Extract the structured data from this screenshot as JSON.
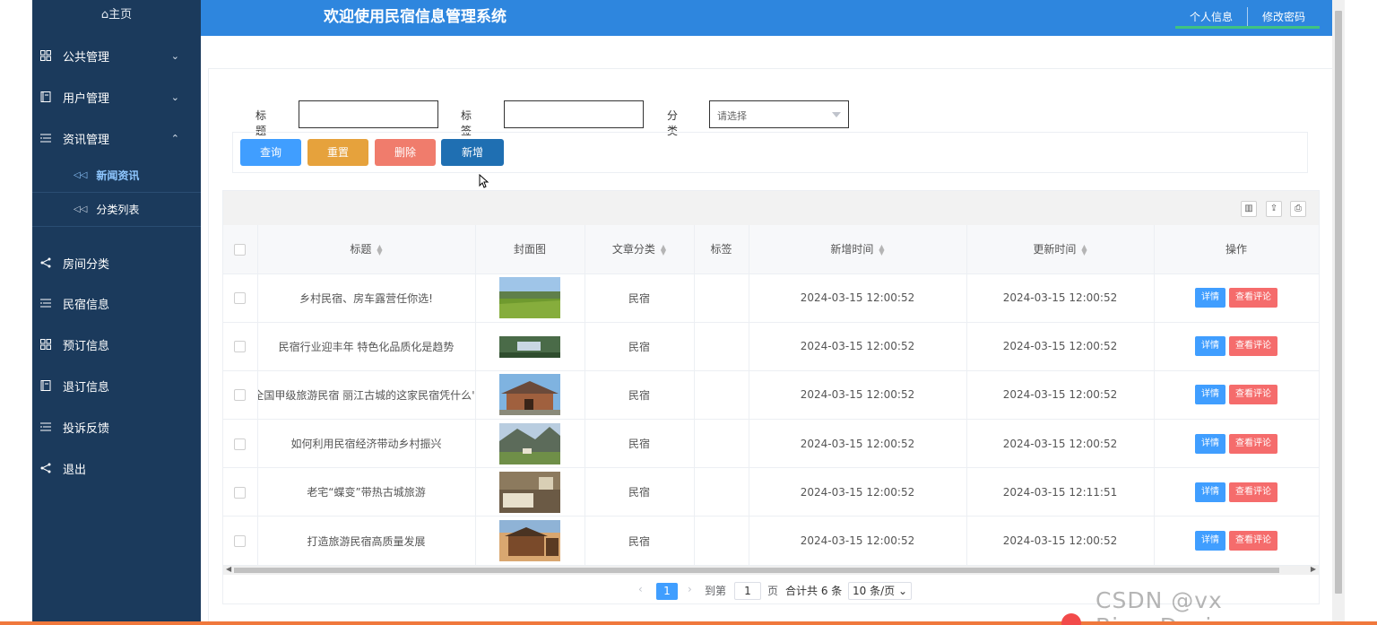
{
  "sidebar": {
    "home_label": "⌂主页",
    "menus": [
      {
        "label": "公共管理",
        "icon": "grid-icon",
        "chevron": "⌄"
      },
      {
        "label": "用户管理",
        "icon": "book-icon",
        "chevron": "⌄"
      },
      {
        "label": "资讯管理",
        "icon": "list-icon",
        "chevron": "⌃"
      }
    ],
    "submenus": [
      {
        "label": "新闻资讯",
        "active": true
      },
      {
        "label": "分类列表",
        "active": false
      }
    ],
    "more_menus": [
      {
        "label": "房间分类",
        "icon": "share-icon"
      },
      {
        "label": "民宿信息",
        "icon": "list-icon"
      },
      {
        "label": "预订信息",
        "icon": "grid-icon"
      },
      {
        "label": "退订信息",
        "icon": "book-icon"
      },
      {
        "label": "投诉反馈",
        "icon": "list-icon"
      },
      {
        "label": "退出",
        "icon": "share-icon"
      }
    ]
  },
  "header": {
    "title": "欢迎使用民宿信息管理系统",
    "profile_link": "个人信息",
    "password_link": "修改密码"
  },
  "search": {
    "title_label": "标题",
    "title_value": "",
    "tag_label": "标签",
    "tag_value": "",
    "category_label": "分类",
    "category_placeholder": "请选择"
  },
  "buttons": {
    "query": "查询",
    "reset": "重置",
    "delete": "删除",
    "add": "新增"
  },
  "colors": {
    "query": "#409eff",
    "reset": "#e6a23c",
    "delete": "#f07c6c",
    "add": "#1f6fb2",
    "sidebar": "#1b3a5c",
    "header": "#2e86de"
  },
  "table": {
    "columns": [
      "标题",
      "封面图",
      "文章分类",
      "标签",
      "新增时间",
      "更新时间",
      "操作"
    ],
    "rows": [
      {
        "title": "乡村民宿、房车露营任你选!",
        "category": "民宿",
        "tag": "",
        "created": "2024-03-15 12:00:52",
        "updated": "2024-03-15 12:00:52"
      },
      {
        "title": "民宿行业迎丰年 特色化品质化是趋势",
        "category": "民宿",
        "tag": "",
        "created": "2024-03-15 12:00:52",
        "updated": "2024-03-15 12:00:52"
      },
      {
        "title": "'全国甲级旅游民宿 丽江古城的这家民宿凭什么",
        "category": "民宿",
        "tag": "",
        "created": "2024-03-15 12:00:52",
        "updated": "2024-03-15 12:00:52"
      },
      {
        "title": "如何利用民宿经济带动乡村振兴",
        "category": "民宿",
        "tag": "",
        "created": "2024-03-15 12:00:52",
        "updated": "2024-03-15 12:00:52"
      },
      {
        "title": "老宅“蝶变”带热古城旅游",
        "category": "民宿",
        "tag": "",
        "created": "2024-03-15 12:00:52",
        "updated": "2024-03-15 12:11:51"
      },
      {
        "title": "打造旅游民宿高质量发展",
        "category": "民宿",
        "tag": "",
        "created": "2024-03-15 12:00:52",
        "updated": "2024-03-15 12:00:52"
      }
    ],
    "detail_label": "详情",
    "comment_label": "查看评论"
  },
  "pager": {
    "prev": "‹",
    "current": "1",
    "next": "›",
    "goto_label": "到第",
    "goto_value": "1",
    "page_unit": "页",
    "total": "合计共 6 条",
    "page_size": "10 条/页"
  },
  "watermark": "CSDN @vx  Biye_Design"
}
